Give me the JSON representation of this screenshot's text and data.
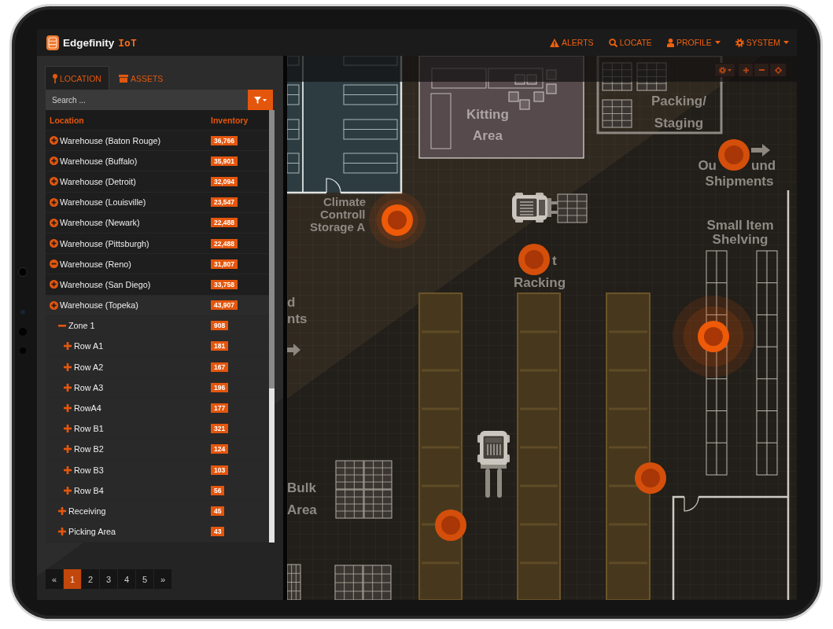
{
  "app": {
    "name": "Edgefinity",
    "suffix": "IoT"
  },
  "nav": [
    {
      "label": "ALERTS",
      "dropdown": false
    },
    {
      "label": "LOCATE",
      "dropdown": false
    },
    {
      "label": "PROFILE",
      "dropdown": true
    },
    {
      "label": "SYSTEM",
      "dropdown": true
    }
  ],
  "tabs": [
    {
      "label": "LOCATION",
      "selected": true
    },
    {
      "label": "ASSETS",
      "selected": false
    }
  ],
  "search": {
    "placeholder": "Search ..."
  },
  "tree": {
    "columns": [
      "Location",
      "Inventory"
    ],
    "items": [
      {
        "label": "Warehouse (Baton Rouge)",
        "count": "36,766",
        "expanded": false,
        "selected": false
      },
      {
        "label": "Warehouse (Buffalo)",
        "count": "35,901",
        "expanded": false,
        "selected": false
      },
      {
        "label": "Warehouse (Detroit)",
        "count": "32,094",
        "expanded": false,
        "selected": false
      },
      {
        "label": "Warehouse (Louisville)",
        "count": "23,547",
        "expanded": false,
        "selected": false
      },
      {
        "label": "Warehouse (Newark)",
        "count": "22,488",
        "expanded": false,
        "selected": false
      },
      {
        "label": "Warehouse (Pittsburgh)",
        "count": "22,488",
        "expanded": false,
        "selected": false
      },
      {
        "label": "Warehouse (Reno)",
        "count": "31,807",
        "expanded": true,
        "selected": false
      },
      {
        "label": "Warehouse (San Diego)",
        "count": "33,758",
        "expanded": false,
        "selected": false
      },
      {
        "label": "Warehouse (Topeka)",
        "count": "43,907",
        "expanded": false,
        "selected": true,
        "children": [
          {
            "label": "Zone 1",
            "count": "908",
            "expanded": true,
            "children": [
              {
                "label": "Row A1",
                "count": "181",
                "expanded": false
              },
              {
                "label": "Row A2",
                "count": "167",
                "expanded": false
              },
              {
                "label": "Row A3",
                "count": "196",
                "expanded": false
              },
              {
                "label": "RowA4",
                "count": "177",
                "expanded": false
              },
              {
                "label": "Row B1",
                "count": "321",
                "expanded": false
              },
              {
                "label": "Row B2",
                "count": "124",
                "expanded": false
              },
              {
                "label": "Row B3",
                "count": "103",
                "expanded": false
              },
              {
                "label": "Row B4",
                "count": "56",
                "expanded": false
              }
            ]
          },
          {
            "label": "Receiving",
            "count": "45",
            "expanded": false
          },
          {
            "label": "Picking Area",
            "count": "43",
            "expanded": false
          }
        ]
      }
    ]
  },
  "pagination": [
    {
      "label": "«",
      "selected": false
    },
    {
      "label": "1",
      "selected": true
    },
    {
      "label": "2",
      "selected": false
    },
    {
      "label": "3",
      "selected": false
    },
    {
      "label": "4",
      "selected": false
    },
    {
      "label": "5",
      "selected": false
    },
    {
      "label": "»",
      "selected": false
    }
  ],
  "map": {
    "labels": [
      {
        "lines": [
          "Kitting",
          "Area"
        ]
      },
      {
        "lines": [
          "Packing/",
          "Staging"
        ]
      },
      {
        "lines": [
          "Ou",
          "und",
          "Shipments"
        ]
      },
      {
        "lines": [
          "Climate",
          "Controll",
          "Storage A"
        ]
      },
      {
        "lines": [
          "Small Item",
          "Shelving"
        ]
      },
      {
        "lines": [
          "t",
          "Racking"
        ]
      },
      {
        "lines": [
          "d",
          "nts"
        ]
      },
      {
        "lines": [
          "Bulk",
          "Area"
        ]
      }
    ],
    "markers": [
      {
        "alert": false
      },
      {
        "alert": true
      },
      {
        "alert": false
      },
      {
        "alert": true
      },
      {
        "alert": false
      },
      {
        "alert": false
      }
    ]
  }
}
